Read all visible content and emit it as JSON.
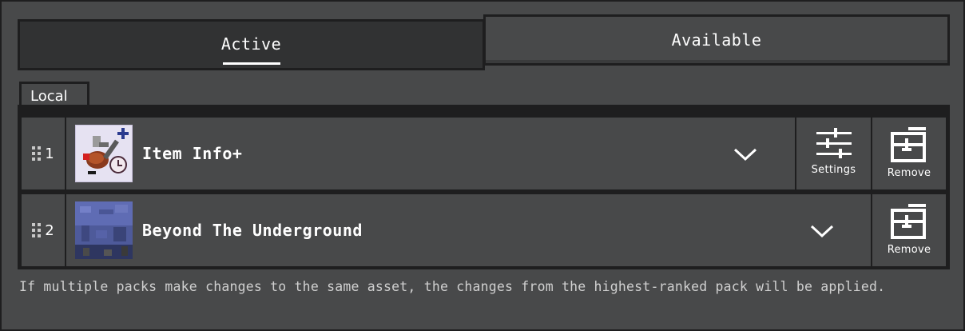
{
  "tabs": [
    {
      "label": "Active",
      "selected": true
    },
    {
      "label": "Available",
      "selected": false
    }
  ],
  "section": {
    "label": "Local"
  },
  "packs": [
    {
      "rank": "1",
      "name": "Item Info+",
      "icon": "item-info-plus-icon",
      "expand_icon": "chevron-down-icon",
      "actions": [
        {
          "label": "Settings",
          "icon": "sliders-icon"
        },
        {
          "label": "Remove",
          "icon": "remove-pack-icon"
        }
      ]
    },
    {
      "rank": "2",
      "name": "Beyond The Underground",
      "icon": "blue-stone-block-icon",
      "expand_icon": "chevron-down-icon",
      "actions": [
        {
          "label": "Remove",
          "icon": "remove-pack-icon"
        }
      ]
    }
  ],
  "footer": {
    "text": "If multiple packs make changes to the same asset, the changes from the highest-ranked pack will be applied."
  },
  "colors": {
    "background": "#48494a",
    "border": "#1e1e1f",
    "selected_tab": "#313233",
    "text": "#ffffff",
    "subtext": "#d0d0d0"
  }
}
